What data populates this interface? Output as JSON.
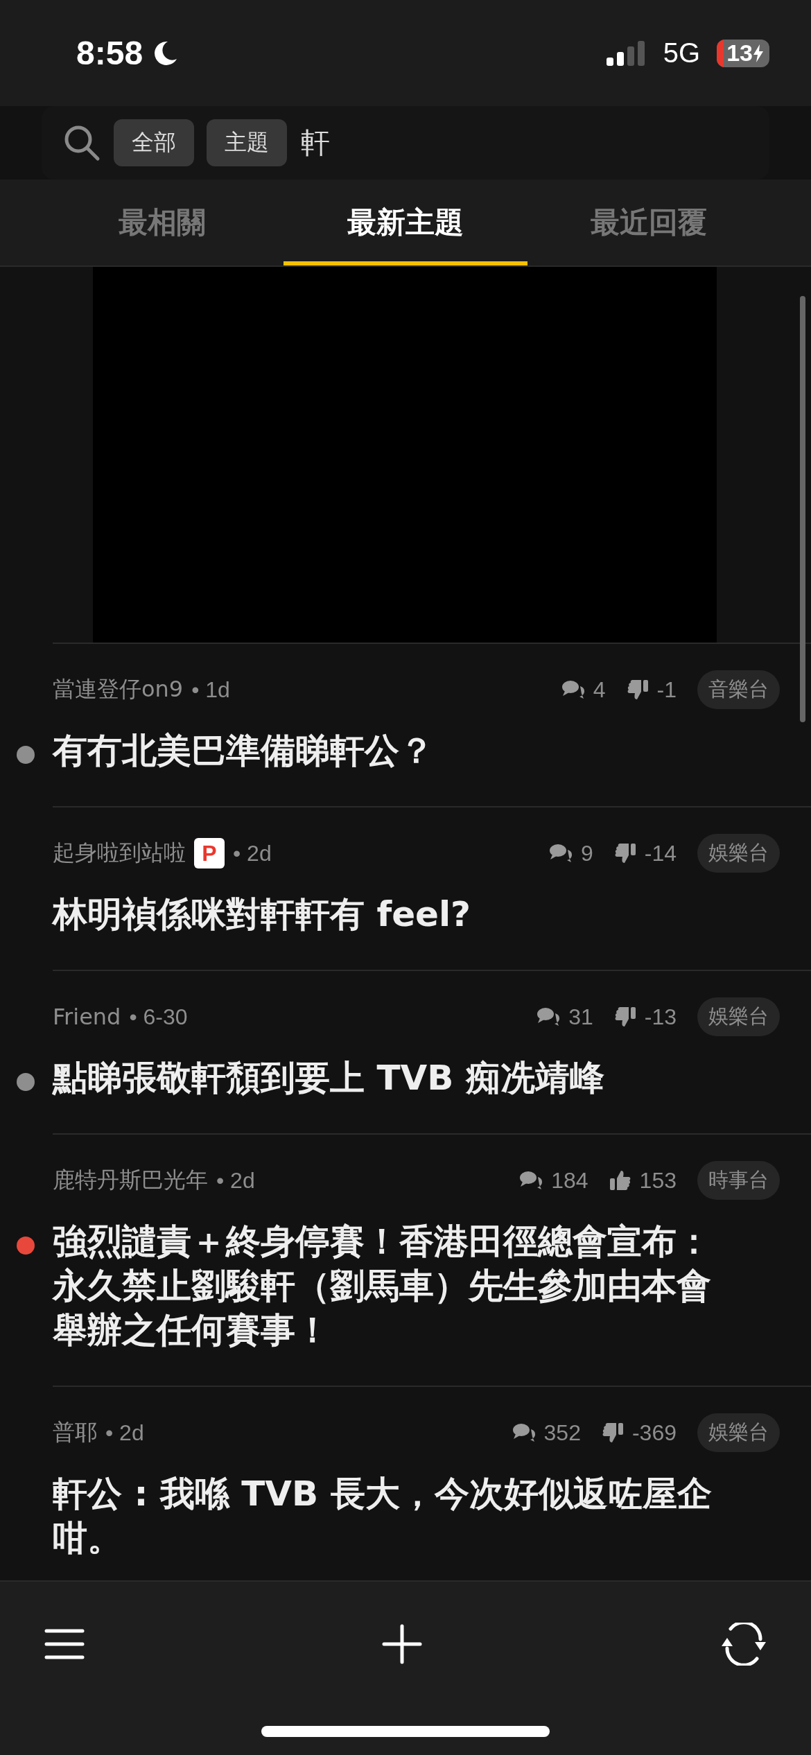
{
  "status_bar": {
    "time": "8:58",
    "network": "5G",
    "battery": "13"
  },
  "search": {
    "filters": [
      "全部",
      "主題"
    ],
    "query": "軒"
  },
  "tabs": [
    {
      "label": "最相關",
      "selected": false
    },
    {
      "label": "最新主題",
      "selected": true
    },
    {
      "label": "最近回覆",
      "selected": false
    }
  ],
  "posts": [
    {
      "author": "當連登仔on9",
      "time": "• 1d",
      "comments": "4",
      "kind": "downvoted",
      "votes": "-1",
      "channel": "音樂台",
      "title": "有冇北美巴準備睇軒公？",
      "color": "#8e8e8e"
    },
    {
      "author": "起身啦到站啦",
      "badge": "P",
      "time": "• 2d",
      "comments": "9",
      "kind": "downvoted",
      "votes": "-14",
      "channel": "娛樂台",
      "title": "林明禎係咪對軒軒有 feel?"
    },
    {
      "author": "Friend",
      "time": "• 6-30",
      "comments": "31",
      "kind": "downvoted",
      "votes": "-13",
      "channel": "娛樂台",
      "title": "點睇張敬軒頹到要上 TVB 痴冼靖峰",
      "color": "#8e8e8e"
    },
    {
      "author": "鹿特丹斯巴光年",
      "time": "• 2d",
      "comments": "184",
      "kind": "upvoted",
      "votes": "153",
      "channel": "時事台",
      "title": "強烈譴責＋終身停賽！香港田徑總會宣布：永久禁止劉駿軒（劉馬車）先生參加由本會舉辦之任何賽事！",
      "color": "#e8483b"
    },
    {
      "author": "普耶",
      "time": "• 2d",
      "comments": "352",
      "kind": "downvoted",
      "votes": "-369",
      "channel": "娛樂台",
      "title": "軒公 : 我喺 TVB 長大，今次好似返咗屋企咁。"
    }
  ]
}
